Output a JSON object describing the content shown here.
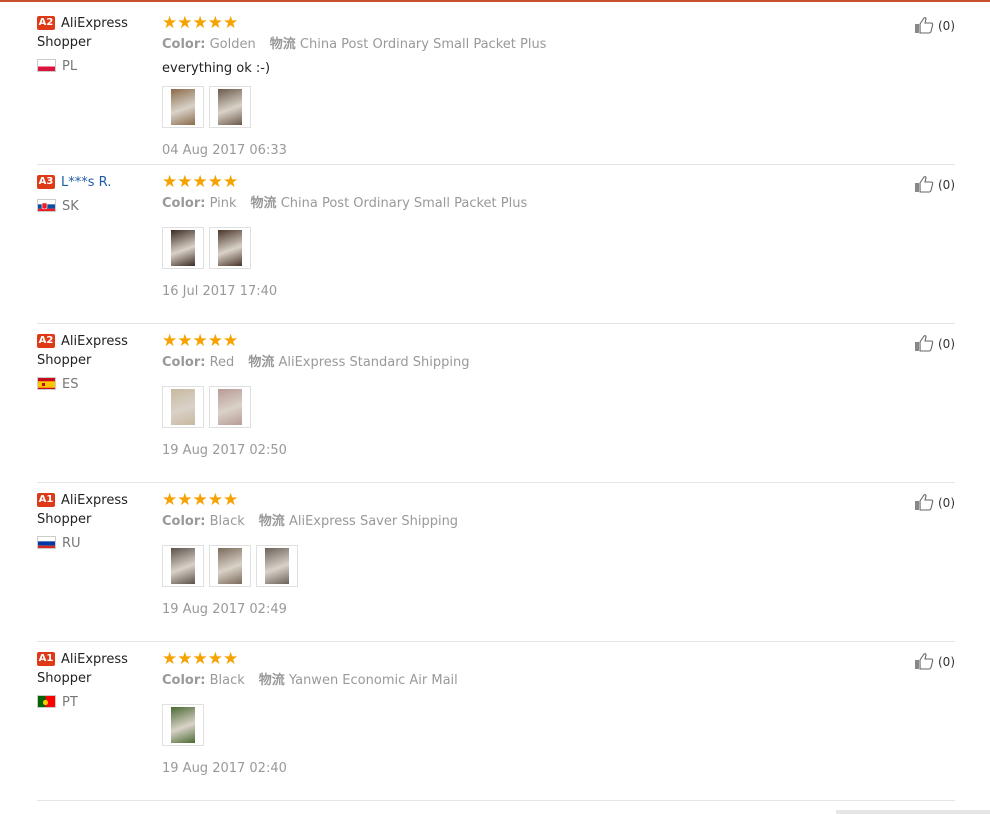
{
  "reviews": [
    {
      "level": "A2",
      "name_line1": "AliExpress",
      "name_line2": "Shopper",
      "country": "PL",
      "flag": "pl",
      "name_is_link": false,
      "color_label": "Color:",
      "color": "Golden",
      "shipping_label": "物流",
      "shipping": "China Post Ordinary Small Packet Plus",
      "feedback": "everything ok :-)",
      "thumbs": [
        "#8a6a4a",
        "#6b5a4a"
      ],
      "date": "04 Aug 2017 06:33",
      "helpful": "(0)"
    },
    {
      "level": "A3",
      "name_line1": "L***s R.",
      "name_line2": "",
      "country": "SK",
      "flag": "sk",
      "name_is_link": true,
      "color_label": "Color:",
      "color": "Pink",
      "shipping_label": "物流",
      "shipping": "China Post Ordinary Small Packet Plus",
      "feedback": "",
      "thumbs": [
        "#3a2a22",
        "#4a3428"
      ],
      "date": "16 Jul 2017 17:40",
      "helpful": "(0)"
    },
    {
      "level": "A2",
      "name_line1": "AliExpress",
      "name_line2": "Shopper",
      "country": "ES",
      "flag": "es",
      "name_is_link": false,
      "color_label": "Color:",
      "color": "Red",
      "shipping_label": "物流",
      "shipping": "AliExpress Standard Shipping",
      "feedback": "",
      "thumbs": [
        "#c8b8a0",
        "#b89a96"
      ],
      "date": "19 Aug 2017 02:50",
      "helpful": "(0)"
    },
    {
      "level": "A1",
      "name_line1": "AliExpress",
      "name_line2": "Shopper",
      "country": "RU",
      "flag": "ru",
      "name_is_link": false,
      "color_label": "Color:",
      "color": "Black",
      "shipping_label": "物流",
      "shipping": "AliExpress Saver Shipping",
      "feedback": "",
      "thumbs": [
        "#5a524a",
        "#7a6a5a",
        "#6a6258"
      ],
      "date": "19 Aug 2017 02:49",
      "helpful": "(0)"
    },
    {
      "level": "A1",
      "name_line1": "AliExpress",
      "name_line2": "Shopper",
      "country": "PT",
      "flag": "pt",
      "name_is_link": false,
      "color_label": "Color:",
      "color": "Black",
      "shipping_label": "物流",
      "shipping": "Yanwen Economic Air Mail",
      "feedback": "",
      "thumbs": [
        "#4a6a32"
      ],
      "date": "19 Aug 2017 02:40",
      "helpful": "(0)"
    }
  ],
  "stars": "★★★★★",
  "colors": {
    "badge": "#df3a17",
    "star": "#f6a200",
    "accent_rule": "#c9502f",
    "link": "#1f5ca8"
  },
  "icons": {
    "like": "thumbs-up-icon"
  }
}
